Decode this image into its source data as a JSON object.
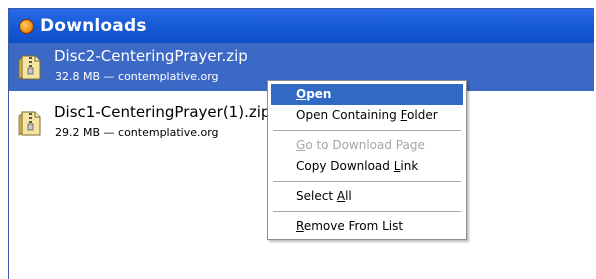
{
  "window": {
    "title": "Downloads",
    "icon": "firefox-icon"
  },
  "downloads": [
    {
      "filename": "Disc2-CenteringPrayer.zip",
      "meta": "32.8 MB — contemplative.org",
      "icon": "zip-file-icon",
      "selected": true
    },
    {
      "filename": "Disc1-CenteringPrayer(1).zip",
      "meta": "29.2 MB — contemplative.org",
      "icon": "zip-file-icon",
      "selected": false
    }
  ],
  "context_menu": {
    "open": {
      "pre": "",
      "key": "O",
      "post": "pen"
    },
    "open_folder": {
      "pre": "Open Containing ",
      "key": "F",
      "post": "older"
    },
    "go_to_page": {
      "pre": "",
      "key": "G",
      "post": "o to Download Page"
    },
    "copy_link": {
      "pre": "Copy Download ",
      "key": "L",
      "post": "ink"
    },
    "select_all": {
      "pre": "Select ",
      "key": "A",
      "post": "ll"
    },
    "remove": {
      "pre": "",
      "key": "R",
      "post": "emove From List"
    }
  },
  "colors": {
    "titlebar": "#175bd8",
    "selection": "#3d69c6",
    "menu_highlight": "#316ac5",
    "disabled_text": "#a7a6aa"
  }
}
